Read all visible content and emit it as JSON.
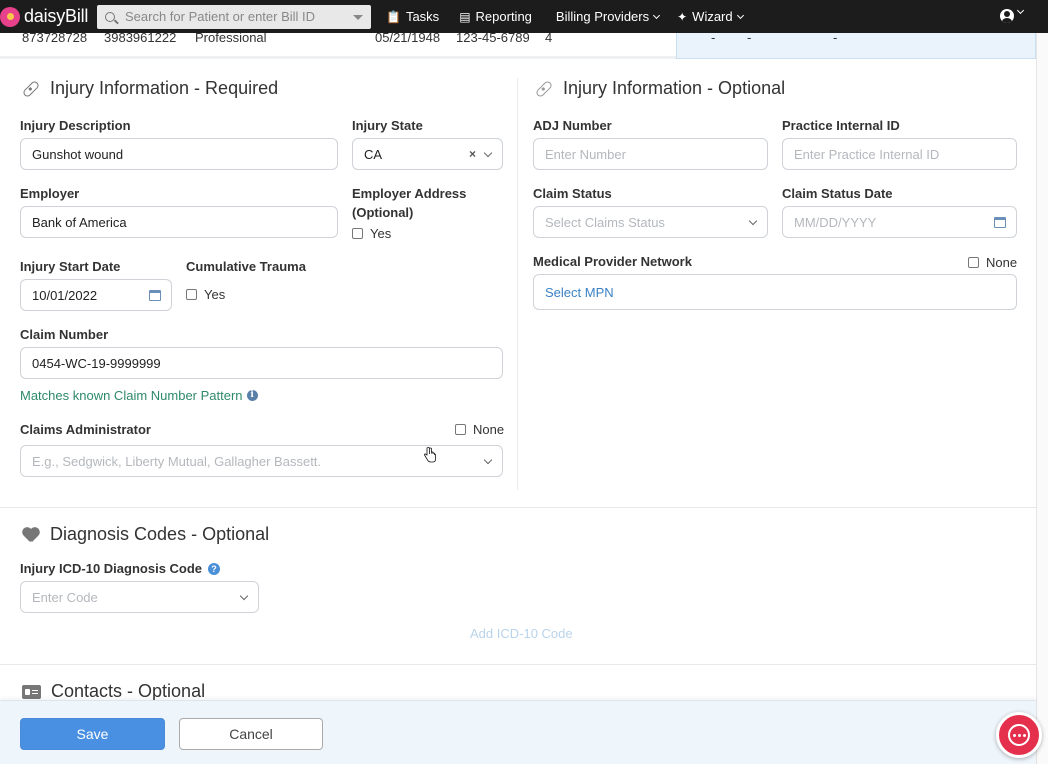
{
  "topbar": {
    "logo_text": "daisyBill",
    "search_placeholder": "Search for Patient or enter Bill ID",
    "nav": {
      "tasks": "Tasks",
      "reporting": "Reporting",
      "billing_providers": "Billing Providers",
      "wizard": "Wizard"
    }
  },
  "partial_row": {
    "c1": "873728728",
    "c2": "3983961222",
    "c3": "Professional",
    "c4": "05/21/1948",
    "c5": "123-45-6789",
    "c6": "4",
    "d1": "-",
    "d2": "-",
    "d3": "-"
  },
  "injury_required": {
    "title": "Injury Information - Required",
    "injury_description_label": "Injury Description",
    "injury_description_value": "Gunshot wound",
    "injury_state_label": "Injury State",
    "injury_state_value": "CA",
    "clear_symbol": "×",
    "employer_label": "Employer",
    "employer_value": "Bank of America",
    "employer_address_label_1": "Employer Address",
    "employer_address_label_2": "(Optional)",
    "employer_address_yes": "Yes",
    "injury_start_date_label": "Injury Start Date",
    "injury_start_date_value": "10/01/2022",
    "cumulative_trauma_label": "Cumulative Trauma",
    "cumulative_trauma_yes": "Yes",
    "claim_number_label": "Claim Number",
    "claim_number_value": "0454-WC-19-9999999",
    "claim_number_hint": "Matches known Claim Number Pattern",
    "info_symbol": "i",
    "claims_admin_label": "Claims Administrator",
    "claims_admin_none": "None",
    "claims_admin_placeholder": "E.g., Sedgwick, Liberty Mutual, Gallagher Bassett."
  },
  "injury_optional": {
    "title": "Injury Information - Optional",
    "adj_number_label": "ADJ Number",
    "adj_number_placeholder": "Enter Number",
    "practice_id_label": "Practice Internal ID",
    "practice_id_placeholder": "Enter Practice Internal ID",
    "claim_status_label": "Claim Status",
    "claim_status_placeholder": "Select Claims Status",
    "claim_status_date_label": "Claim Status Date",
    "claim_status_date_placeholder": "MM/DD/YYYY",
    "mpn_label": "Medical Provider Network",
    "mpn_none": "None",
    "mpn_select": "Select MPN"
  },
  "diagnosis": {
    "title": "Diagnosis Codes - Optional",
    "icd_label": "Injury ICD-10 Diagnosis Code",
    "help_symbol": "?",
    "code_placeholder": "Enter Code",
    "add_link": "Add ICD-10 Code"
  },
  "contacts": {
    "title": "Contacts - Optional"
  },
  "footer": {
    "save": "Save",
    "cancel": "Cancel"
  },
  "colors": {
    "accent": "#4a90e2",
    "hint_green": "#2e8a6a",
    "chat": "#e4304c",
    "topbar": "#1c1c1c"
  }
}
